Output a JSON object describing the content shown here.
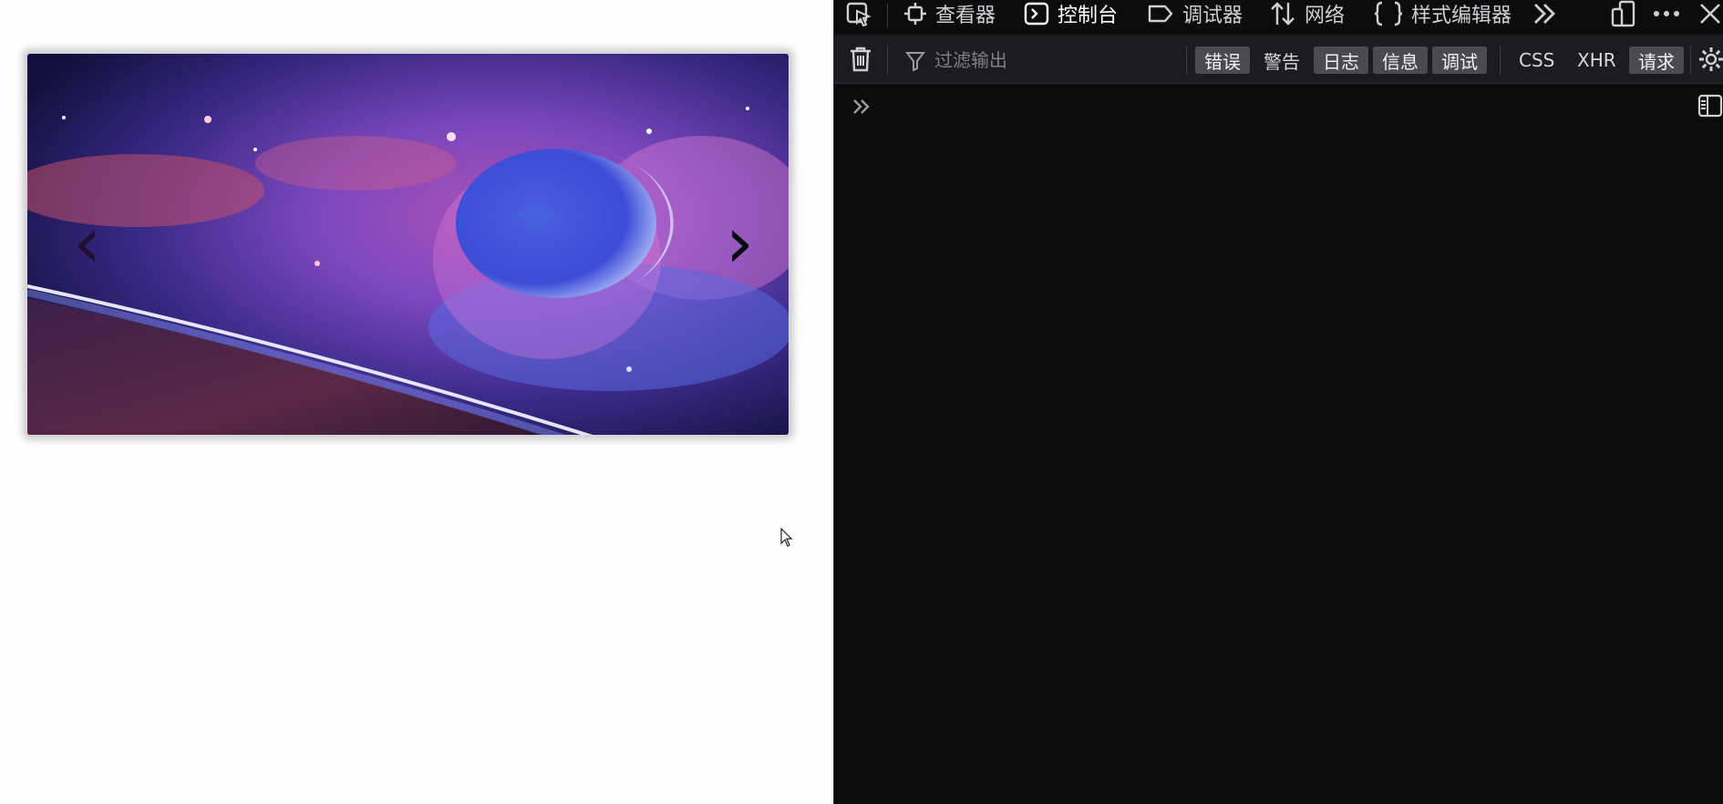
{
  "page": {
    "carousel": {
      "prev_label": "‹",
      "next_label": "›",
      "image_description_icon": "space-nebula-planet-image"
    }
  },
  "devtools": {
    "tabs": [
      {
        "label": "查看器",
        "icon": "inspector-icon"
      },
      {
        "label": "控制台",
        "icon": "console-icon",
        "active": true
      },
      {
        "label": "调试器",
        "icon": "debugger-icon"
      },
      {
        "label": "网络",
        "icon": "network-icon"
      },
      {
        "label": "样式编辑器",
        "icon": "style-editor-icon"
      }
    ],
    "filter_placeholder": "过滤输出",
    "filter_chips": [
      {
        "label": "错误",
        "on": true
      },
      {
        "label": "警告",
        "on": false
      },
      {
        "label": "日志",
        "on": true
      },
      {
        "label": "信息",
        "on": true
      },
      {
        "label": "调试",
        "on": true
      },
      {
        "label": "CSS",
        "on": false
      },
      {
        "label": "XHR",
        "on": false
      },
      {
        "label": "请求",
        "on": true
      }
    ],
    "colors": {
      "background": "#0c0c0d",
      "toolbar": "#1c1b22",
      "chip_on": "#4a4a52",
      "text": "#cfcfd4"
    }
  }
}
